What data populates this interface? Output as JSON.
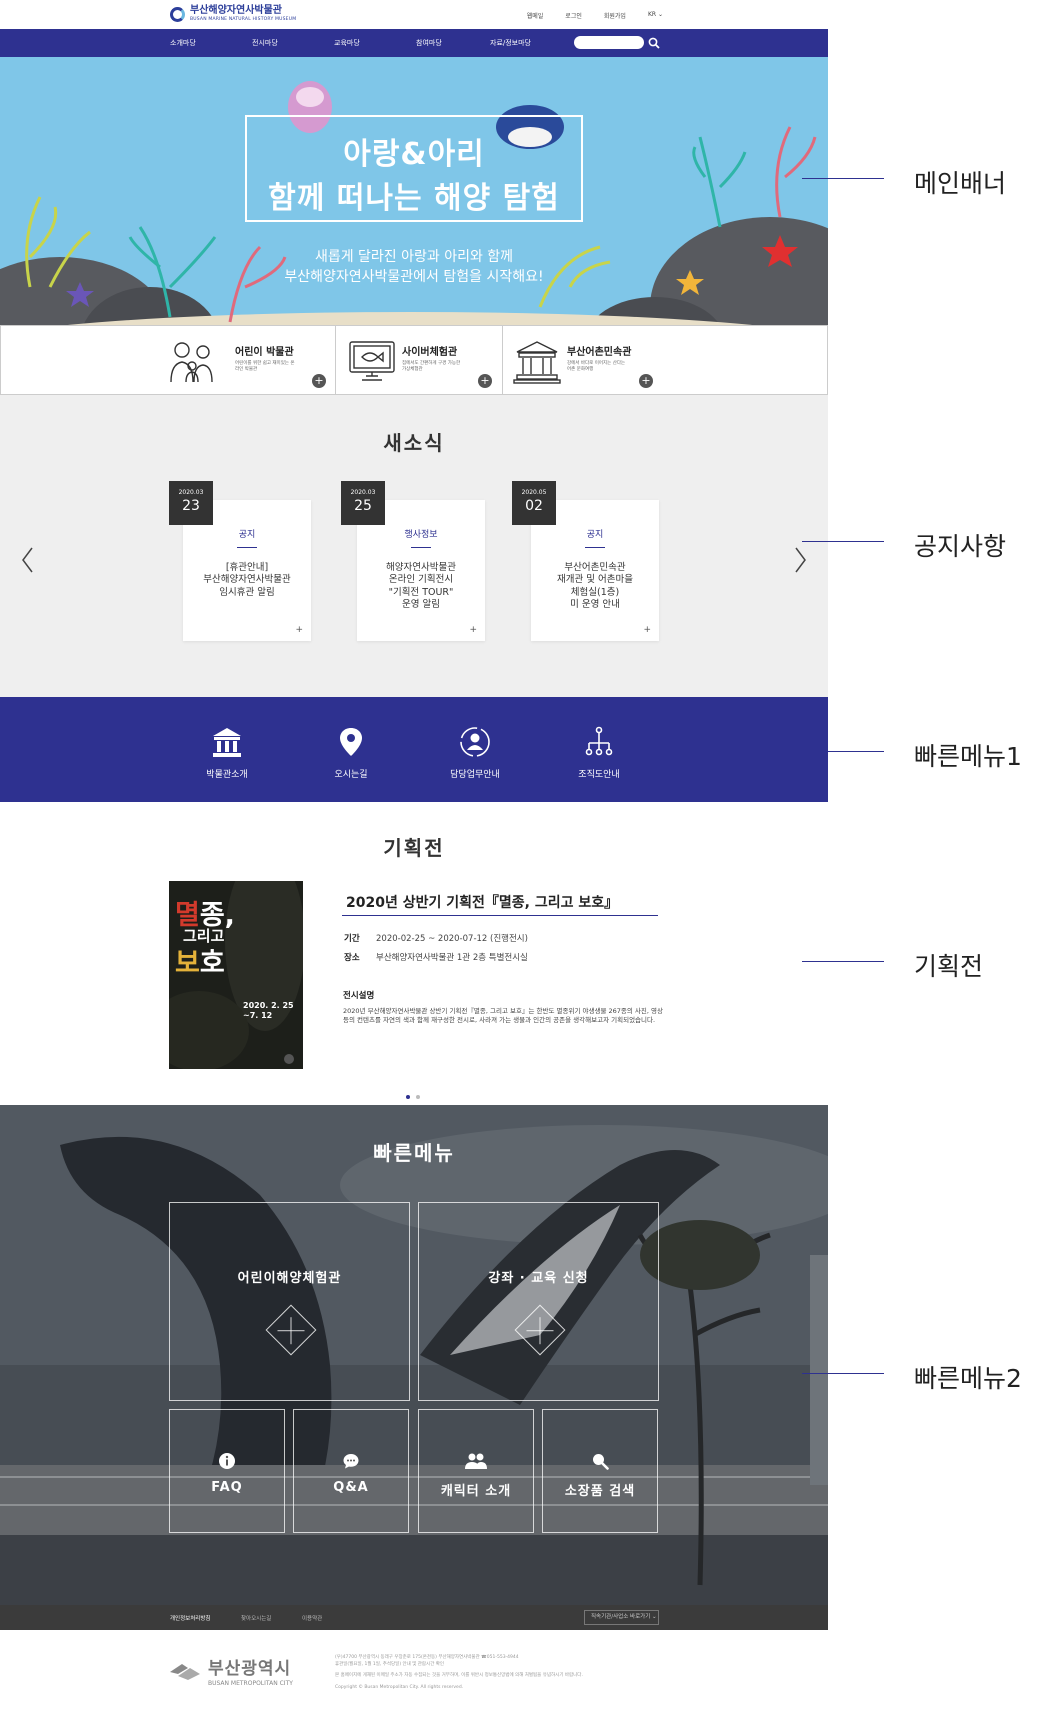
{
  "header": {
    "logo_ko": "부산해양자연사박물관",
    "logo_en": "BUSAN MARINE NATURAL HISTORY MUSEUM",
    "util": [
      "웹메일",
      "로그인",
      "회원가입",
      "KR ⌄"
    ]
  },
  "gnb": {
    "items": [
      "소개마당",
      "전시마당",
      "교육마당",
      "참여마당",
      "자료/정보마당"
    ],
    "search_placeholder": ""
  },
  "hero": {
    "title1": "아랑&아리",
    "title2": "함께 떠나는 해양 탐험",
    "sub1": "새롭게 달라진 아랑과 아리와 함께",
    "sub2": "부산해양자연사박물관에서 탐험을 시작해요!"
  },
  "museums": [
    {
      "title": "어린이 박물관",
      "desc": "어린이를 위한 쉽고 재미있는 온라인 박물관"
    },
    {
      "title": "사이버체험관",
      "desc": "집에서도 간편하게 구경 가능한 가상체험관"
    },
    {
      "title": "부산어촌민속관",
      "desc": "강에서 바다로 이어지는 산다는 어촌 문화여행"
    }
  ],
  "news": {
    "title": "새소식",
    "items": [
      {
        "ym": "2020.03",
        "d": "23",
        "cat": "공지",
        "title": "[휴관안내]\n부산해양자연사박물관\n임시휴관 알림"
      },
      {
        "ym": "2020.03",
        "d": "25",
        "cat": "행사정보",
        "title": "해양자연사박물관\n온라인 기획전시\n\"기획전 TOUR\"\n운영 알림"
      },
      {
        "ym": "2020.05",
        "d": "02",
        "cat": "공지",
        "title": "부산어촌민속관\n재개관 및 어촌마을\n체험실(1층)\n미 운영 안내"
      }
    ],
    "plus": "+"
  },
  "quick1": [
    "박물관소개",
    "오시는길",
    "담당업무안내",
    "조직도안내"
  ],
  "exhibit": {
    "section_title": "기획전",
    "poster": {
      "l1a": "멸",
      "l1b": "종,",
      "l2": "그리고",
      "l3a": "보",
      "l3b": "호",
      "date1": "2020. 2. 25",
      "date2": "~7. 12"
    },
    "title": "2020년 상반기 기획전『멸종, 그리고 보호』",
    "period_label": "기간",
    "period": "2020-02-25 ~ 2020-07-12 (진행전시)",
    "place_label": "장소",
    "place": "부산해양자연사박물관 1관 2층 특별전시실",
    "desc_title": "전시설명",
    "desc": "2020년 부산해양자연사박물관 상반기 기획전『멸종, 그리고 보호』는 한반도 멸종위기 야생생물 267종의 사진, 영상 등의 컨텐츠를 자연의 색과 함께 재구성한 전시로, 사라져 가는 생물과 인간의 공존을 생각해보고자 기획되었습니다."
  },
  "quick2": {
    "title": "빠른메뉴",
    "big": [
      "어린이해양체험관",
      "강좌 · 교육 신청"
    ],
    "small": [
      "FAQ",
      "Q&A",
      "캐릭터 소개",
      "소장품 검색"
    ]
  },
  "footer": {
    "links": [
      "개인정보처리방침",
      "찾아오시는길",
      "이용약관"
    ],
    "select": "직속기관/사업소 바로가기 ⌄",
    "logo_ko": "부산광역시",
    "logo_en": "BUSAN METROPOLITAN CITY",
    "info1": "(우)47700 부산광역시 동래구 우장춘로 175(온천동) 부산해양자연사박물관 ☎051-553-4944",
    "info2": "휴관일(월요일, 1월 1일, 추석당일) 안내 및 관람시간 확인",
    "info3": "본 홈페이지에 게재된 이메일 주소가 자동 수집되는 것을 거부하며, 이를 위반시 정보통신망법에 의해 처벌됨을 유념하시기 바랍니다.",
    "info4": "Copyright © Busan Metropolitan City. All rights reserved."
  },
  "annotations": [
    "메인배너",
    "공지사항",
    "빠른메뉴1",
    "기획전",
    "빠른메뉴2"
  ],
  "colors": {
    "primary": "#2e3190",
    "hero_bg": "#7fc6e8",
    "news_bg": "#efefef"
  }
}
